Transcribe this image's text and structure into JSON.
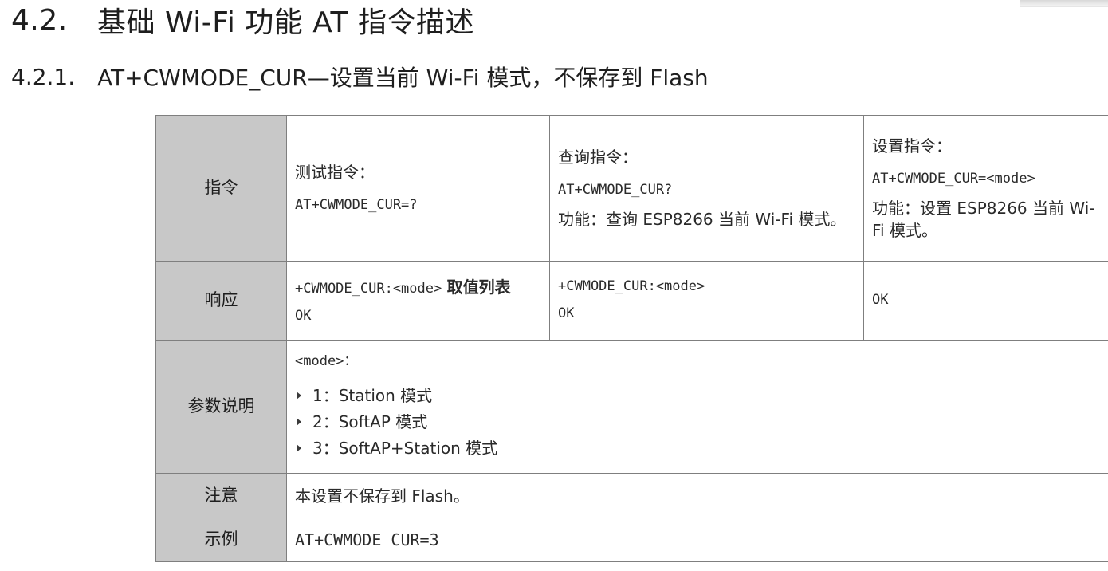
{
  "section": {
    "number": "4.2.",
    "title": "基础 Wi-Fi 功能 AT 指令描述"
  },
  "subsection": {
    "number": "4.2.1.",
    "title": "AT+CWMODE_CUR—设置当前 Wi-Fi 模式，不保存到 Flash"
  },
  "table": {
    "rows": {
      "command": {
        "label": "指令",
        "test": {
          "title": "测试指令：",
          "code": "AT+CWMODE_CUR=?"
        },
        "query": {
          "title": "查询指令：",
          "code": "AT+CWMODE_CUR?",
          "desc": "功能：查询 ESP8266 当前 Wi-Fi 模式。"
        },
        "set": {
          "title": "设置指令：",
          "code": "AT+CWMODE_CUR=<mode>",
          "desc": "功能：设置 ESP8266 当前 Wi-Fi 模式。"
        }
      },
      "response": {
        "label": "响应",
        "test": {
          "code": "+CWMODE_CUR:<mode>",
          "suffix": "取值列表",
          "ok": "OK"
        },
        "query": {
          "code": "+CWMODE_CUR:<mode>",
          "ok": "OK"
        },
        "set": {
          "ok": "OK"
        }
      },
      "params": {
        "label": "参数说明",
        "name": "<mode>：",
        "items": [
          "1：Station 模式",
          "2：SoftAP 模式",
          "3：SoftAP+Station 模式"
        ]
      },
      "note": {
        "label": "注意",
        "text": "本设置不保存到 Flash。"
      },
      "example": {
        "label": "示例",
        "code": "AT+CWMODE_CUR=3"
      }
    }
  }
}
